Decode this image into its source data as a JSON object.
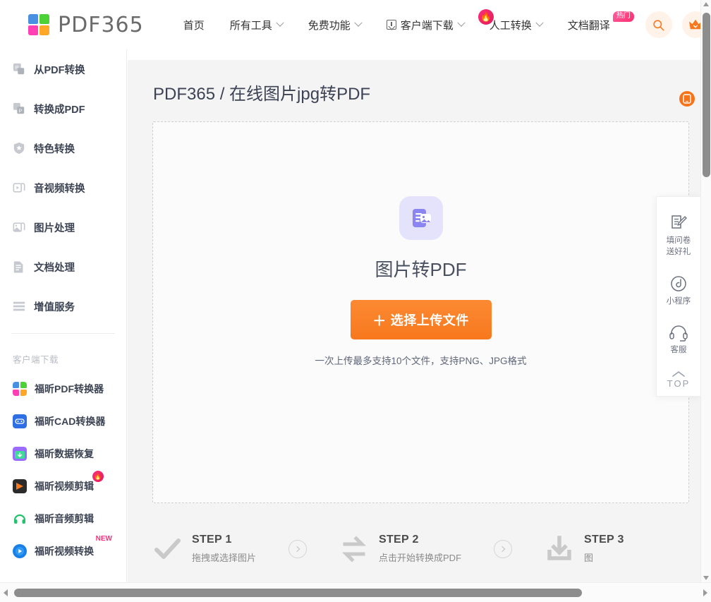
{
  "header": {
    "logo_text": "PDF365",
    "logo_colors": [
      "#4a90e2",
      "#4cd137",
      "#ff3fb4",
      "#ffa726"
    ],
    "nav": [
      {
        "label": "首页",
        "caret": false,
        "pre_icon": null,
        "badge": null
      },
      {
        "label": "所有工具",
        "caret": true,
        "pre_icon": null,
        "badge": null
      },
      {
        "label": "免费功能",
        "caret": true,
        "pre_icon": null,
        "badge": null
      },
      {
        "label": "客户端下载",
        "caret": true,
        "pre_icon": "download-box-icon",
        "badge": null
      },
      {
        "label": "人工转换",
        "caret": true,
        "pre_icon": null,
        "badge": "fire"
      },
      {
        "label": "文档翻译",
        "caret": false,
        "pre_icon": null,
        "badge": "热门"
      }
    ],
    "search_icon": "search-icon",
    "vip_icon": "crown-icon",
    "accent": "#f7781d"
  },
  "sidebar": {
    "items": [
      {
        "label": "从PDF转换",
        "icon": "from-pdf-icon"
      },
      {
        "label": "转换成PDF",
        "icon": "to-pdf-icon"
      },
      {
        "label": "特色转换",
        "icon": "shield-star-icon"
      },
      {
        "label": "音视频转换",
        "icon": "media-icon"
      },
      {
        "label": "图片处理",
        "icon": "image-icon"
      },
      {
        "label": "文档处理",
        "icon": "document-icon"
      },
      {
        "label": "增值服务",
        "icon": "list-icon"
      }
    ],
    "section_title": "客户端下载",
    "apps": [
      {
        "label": "福昕PDF转换器",
        "icon": "foxit-pdf-icon",
        "badge": null
      },
      {
        "label": "福昕CAD转换器",
        "icon": "foxit-cad-icon",
        "badge": null
      },
      {
        "label": "福昕数据恢复",
        "icon": "foxit-recovery-icon",
        "badge": null
      },
      {
        "label": "福昕视频剪辑",
        "icon": "foxit-video-edit-icon",
        "badge": "fire"
      },
      {
        "label": "福昕音频剪辑",
        "icon": "foxit-audio-edit-icon",
        "badge": null
      },
      {
        "label": "福昕视频转换",
        "icon": "foxit-video-convert-icon",
        "badge": "NEW"
      }
    ]
  },
  "main": {
    "page_title": "PDF365 / 在线图片jpg转PDF",
    "mobile_icon": "mobile-icon",
    "dropzone": {
      "icon": "image-to-pdf-icon",
      "title": "图片转PDF",
      "button_label": "选择上传文件",
      "button_plus": "＋",
      "hint": "一次上传最多支持10个文件，支持PNG、JPG格式"
    },
    "steps": [
      {
        "title": "STEP 1",
        "subtitle": "拖拽或选择图片",
        "icon": "check-icon"
      },
      {
        "title": "STEP 2",
        "subtitle": "点击开始转换成PDF",
        "icon": "convert-arrows-icon"
      },
      {
        "title": "STEP 3",
        "subtitle": "图",
        "icon": "download-icon"
      }
    ]
  },
  "float_panel": {
    "items": [
      {
        "label": "填问卷\n送好礼",
        "icon": "survey-pencil-icon"
      },
      {
        "label": "小程序",
        "icon": "miniprogram-icon"
      },
      {
        "label": "客服",
        "icon": "headset-icon"
      }
    ],
    "top_label": "TOP",
    "top_icon": "chevron-up-icon"
  },
  "scrollbars": {
    "vertical": {
      "thumb_color": "#8d8d8d"
    },
    "horizontal": {
      "thumb_color": "#8d8d8d"
    }
  }
}
